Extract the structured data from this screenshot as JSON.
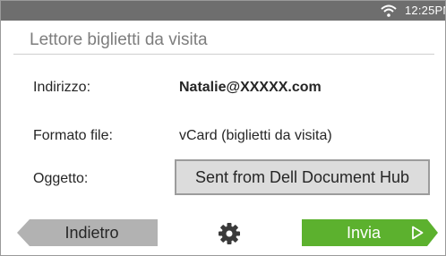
{
  "status_bar": {
    "time": "12:25PM",
    "icons": [
      "wifi-icon"
    ]
  },
  "screen": {
    "title": "Lettore biglietti da visita"
  },
  "fields": {
    "address": {
      "label": "Indirizzo:",
      "value": "Natalie@XXXXX.com"
    },
    "file_format": {
      "label": "Formato file:",
      "value": "vCard (biglietti da visita)"
    },
    "subject": {
      "label": "Oggetto:",
      "value": "Sent from Dell Document Hub"
    }
  },
  "footer": {
    "back_label": "Indietro",
    "settings_icon": "gear-icon",
    "send_label": "Invia",
    "send_icon": "play-arrow-icon"
  },
  "colors": {
    "status_bar": "#6e6e6e",
    "send_button": "#5cb12e",
    "back_button": "#b2b2b2",
    "subject_field": "#dcdcdc"
  }
}
